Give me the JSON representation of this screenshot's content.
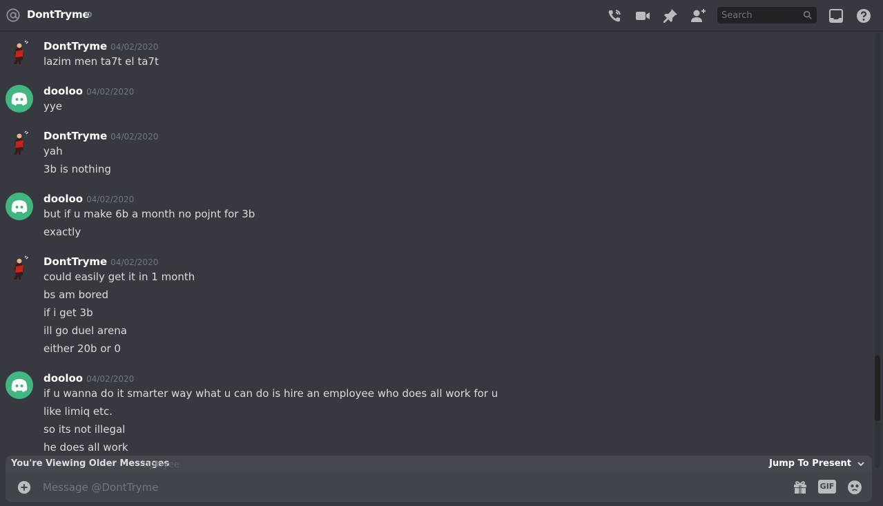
{
  "header": {
    "dm_name": "DontTryme",
    "search_placeholder": "Search"
  },
  "messages": [
    {
      "author": "DontTryme",
      "timestamp": "04/02/2020",
      "avatar": "custom",
      "lines": [
        "lazim men ta7t el ta7t"
      ]
    },
    {
      "author": "dooloo",
      "timestamp": "04/02/2020",
      "avatar": "discord",
      "lines": [
        "yye"
      ]
    },
    {
      "author": "DontTryme",
      "timestamp": "04/02/2020",
      "avatar": "custom",
      "lines": [
        "yah",
        "3b is nothing"
      ]
    },
    {
      "author": "dooloo",
      "timestamp": "04/02/2020",
      "avatar": "discord",
      "lines": [
        "but if u make 6b a month no pojnt for 3b",
        "exactly"
      ]
    },
    {
      "author": "DontTryme",
      "timestamp": "04/02/2020",
      "avatar": "custom",
      "lines": [
        "could easily get it in 1 month",
        "bs am bored",
        "if i get 3b",
        "ill go duel arena",
        "either 20b or 0"
      ]
    },
    {
      "author": "dooloo",
      "timestamp": "04/02/2020",
      "avatar": "discord",
      "lines": [
        "if u wanna do it smarter way what u can do is hire an employee who does all work for u",
        "like limiq etc.",
        "so its not illegal",
        "he does all work"
      ]
    }
  ],
  "older_bar": {
    "label": "You're Viewing Older Messages",
    "ghost_text": "nployee",
    "jump_label": "Jump To Present"
  },
  "composer": {
    "placeholder": "Message @DontTryme",
    "gif_label": "GIF"
  },
  "colors": {
    "background": "#36393f",
    "discord_green": "#43b581",
    "composer": "#40444b"
  }
}
